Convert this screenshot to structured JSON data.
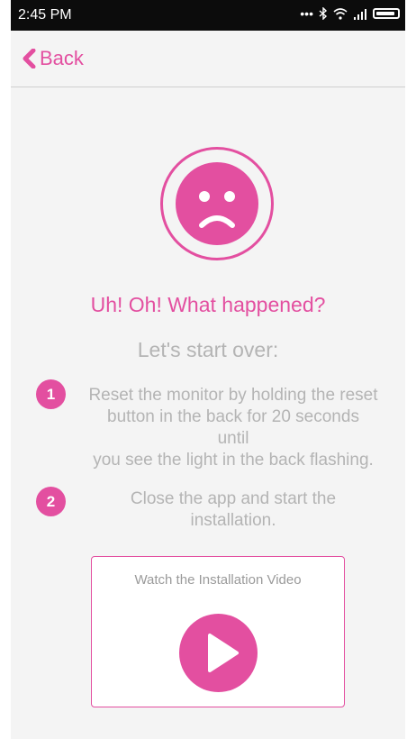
{
  "status_bar": {
    "time": "2:45 PM",
    "icons": [
      "more-dots-icon",
      "bluetooth-icon",
      "wifi-icon",
      "signal-icon",
      "battery-icon"
    ]
  },
  "nav": {
    "back_label": "Back"
  },
  "error": {
    "icon": "sad-face-icon",
    "headline": "Uh! Oh! What happened?",
    "subhead": "Let's start over:"
  },
  "steps": [
    {
      "number": "1",
      "lines": [
        "Reset the monitor by holding the reset",
        "button in the back for 20 seconds",
        "until",
        "you see the light in the back flashing."
      ]
    },
    {
      "number": "2",
      "lines": [
        "Close the app and start the",
        "installation."
      ]
    }
  ],
  "video": {
    "label": "Watch the Installation Video",
    "icon": "play-icon"
  },
  "colors": {
    "accent": "#e34fa0",
    "muted_text": "#b4b4b4",
    "background": "#f4f4f4",
    "status_bar": "#0c0c0c"
  }
}
